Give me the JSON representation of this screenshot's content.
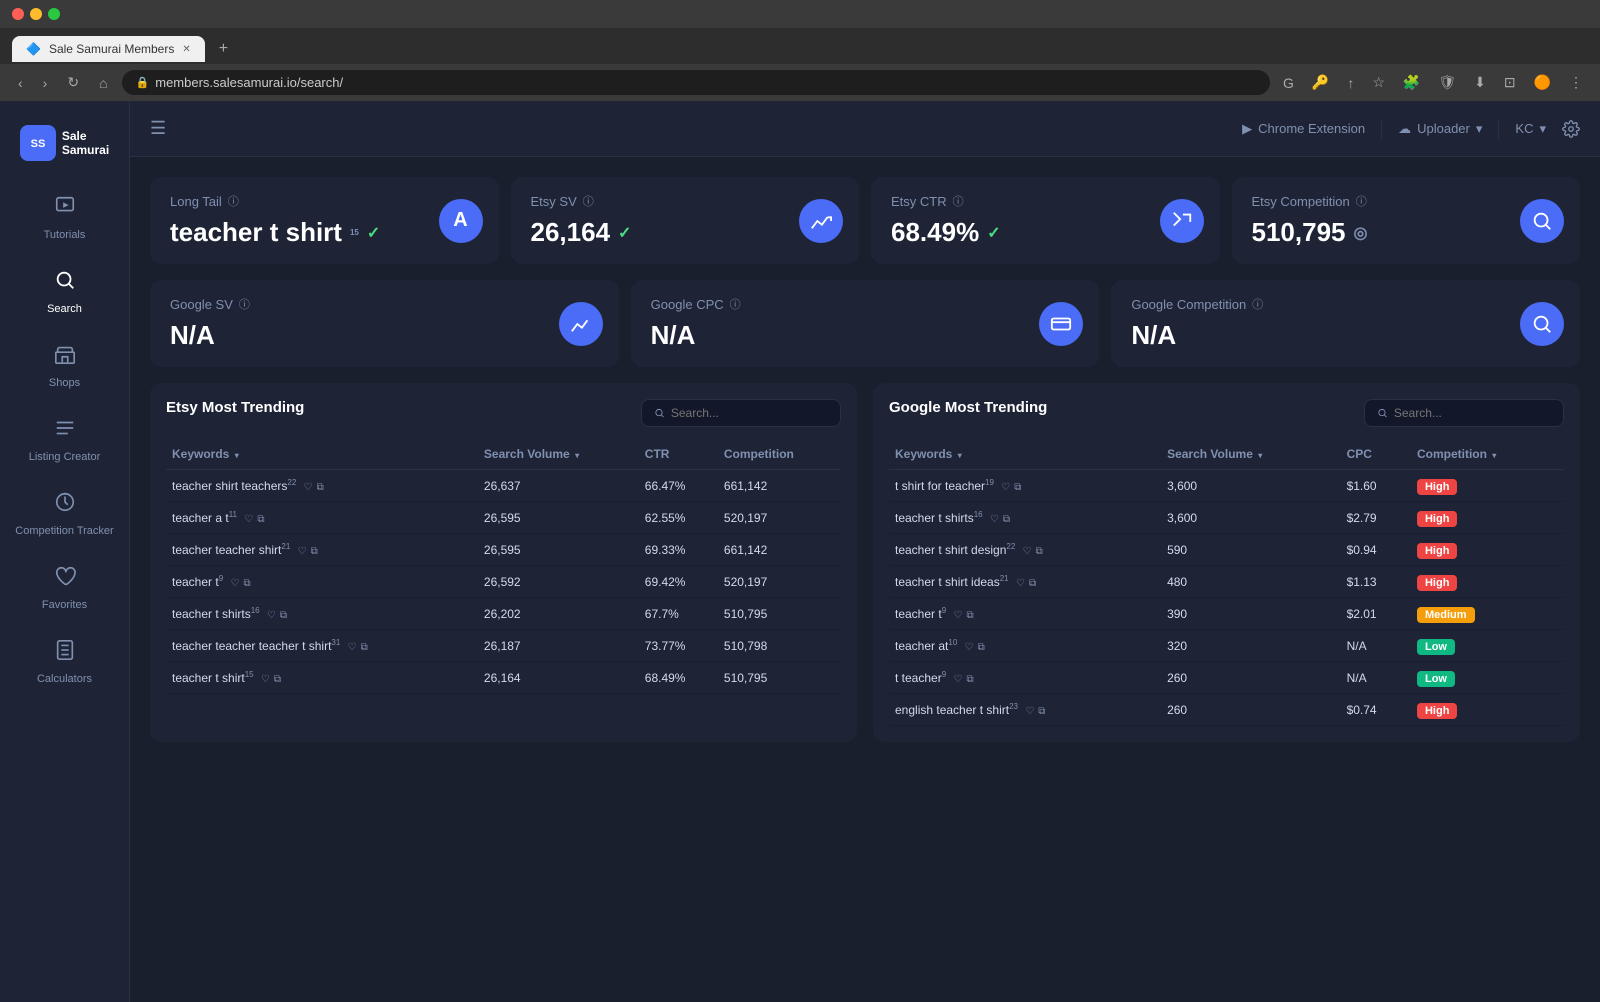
{
  "browser": {
    "tab_title": "Sale Samurai Members",
    "url": "members.salesamurai.io/search/",
    "new_tab_label": "+"
  },
  "topnav": {
    "chrome_extension_label": "Chrome Extension",
    "uploader_label": "Uploader",
    "user_label": "KC",
    "settings_icon": "⚙"
  },
  "sidebar": {
    "logo_text1": "Sale",
    "logo_text2": "Samurai",
    "items": [
      {
        "id": "tutorials",
        "icon": "🎬",
        "label": "Tutorials"
      },
      {
        "id": "search",
        "icon": "🔍",
        "label": "Search"
      },
      {
        "id": "shops",
        "icon": "🏪",
        "label": "Shops"
      },
      {
        "id": "listing-creator",
        "icon": "☰",
        "label": "Listing Creator"
      },
      {
        "id": "competition-tracker",
        "icon": "⏱",
        "label": "Competition Tracker"
      },
      {
        "id": "favorites",
        "icon": "♡",
        "label": "Favorites"
      },
      {
        "id": "calculators",
        "icon": "🧮",
        "label": "Calculators"
      }
    ]
  },
  "stats": {
    "long_tail": {
      "label": "Long Tail",
      "value": "teacher t shirt",
      "superscript": "15",
      "icon": "A"
    },
    "etsy_sv": {
      "label": "Etsy SV",
      "value": "26,164",
      "icon": "📈"
    },
    "etsy_ctr": {
      "label": "Etsy CTR",
      "value": "68.49%",
      "icon": "🖱"
    },
    "etsy_competition": {
      "label": "Etsy Competition",
      "value": "510,795",
      "icon": "🔍"
    }
  },
  "stats2": {
    "google_sv": {
      "label": "Google SV",
      "value": "N/A",
      "icon": "📈"
    },
    "google_cpc": {
      "label": "Google CPC",
      "value": "N/A",
      "icon": "💵"
    },
    "google_competition": {
      "label": "Google Competition",
      "value": "N/A",
      "icon": "🔍"
    }
  },
  "etsy_trending": {
    "title": "Etsy Most Trending",
    "search_placeholder": "Search...",
    "columns": [
      "Keywords",
      "Search Volume",
      "CTR",
      "Competition"
    ],
    "rows": [
      {
        "keyword": "teacher shirt teachers",
        "sup": "22",
        "sv": "26,637",
        "ctr": "66.47%",
        "competition": "661,142"
      },
      {
        "keyword": "teacher a t",
        "sup": "11",
        "sv": "26,595",
        "ctr": "62.55%",
        "competition": "520,197"
      },
      {
        "keyword": "teacher teacher shirt",
        "sup": "21",
        "sv": "26,595",
        "ctr": "69.33%",
        "competition": "661,142"
      },
      {
        "keyword": "teacher t",
        "sup": "9",
        "sv": "26,592",
        "ctr": "69.42%",
        "competition": "520,197"
      },
      {
        "keyword": "teacher t shirts",
        "sup": "16",
        "sv": "26,202",
        "ctr": "67.7%",
        "competition": "510,795"
      },
      {
        "keyword": "teacher teacher teacher t shirt",
        "sup": "31",
        "sv": "26,187",
        "ctr": "73.77%",
        "competition": "510,798"
      },
      {
        "keyword": "teacher t shirt",
        "sup": "15",
        "sv": "26,164",
        "ctr": "68.49%",
        "competition": "510,795"
      }
    ]
  },
  "google_trending": {
    "title": "Google Most Trending",
    "search_placeholder": "Search...",
    "columns": [
      "Keywords",
      "Search Volume",
      "CPC",
      "Competition"
    ],
    "rows": [
      {
        "keyword": "t shirt for teacher",
        "sup": "19",
        "sv": "3,600",
        "cpc": "$1.60",
        "competition": "High"
      },
      {
        "keyword": "teacher t shirts",
        "sup": "16",
        "sv": "3,600",
        "cpc": "$2.79",
        "competition": "High"
      },
      {
        "keyword": "teacher t shirt design",
        "sup": "22",
        "sv": "590",
        "cpc": "$0.94",
        "competition": "High"
      },
      {
        "keyword": "teacher t shirt ideas",
        "sup": "21",
        "sv": "480",
        "cpc": "$1.13",
        "competition": "High"
      },
      {
        "keyword": "teacher t",
        "sup": "9",
        "sv": "390",
        "cpc": "$2.01",
        "competition": "Medium"
      },
      {
        "keyword": "teacher at",
        "sup": "10",
        "sv": "320",
        "cpc": "N/A",
        "competition": "Low"
      },
      {
        "keyword": "t teacher",
        "sup": "9",
        "sv": "260",
        "cpc": "N/A",
        "competition": "Low"
      },
      {
        "keyword": "english teacher t shirt",
        "sup": "23",
        "sv": "260",
        "cpc": "$0.74",
        "competition": "High"
      }
    ]
  }
}
